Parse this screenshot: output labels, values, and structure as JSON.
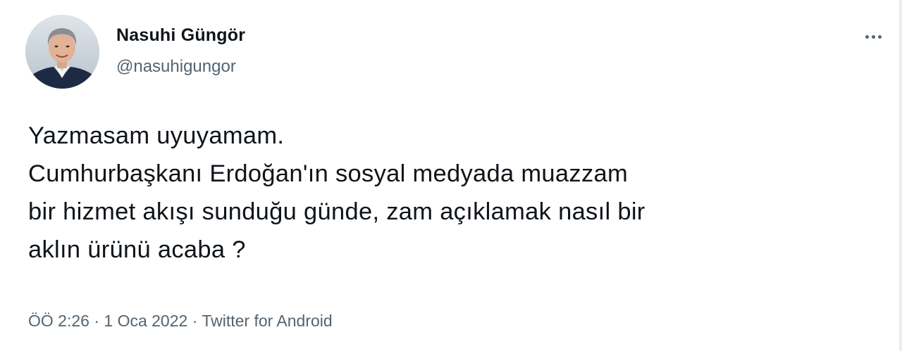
{
  "author": {
    "display_name": "Nasuhi Güngör",
    "handle": "@nasuhigungor",
    "avatar_icon": "profile-photo"
  },
  "more_icon": "ellipsis-icon",
  "tweet": {
    "text": "Yazmasam uyuyamam.\nCumhurbaşkanı Erdoğan'ın sosyal medyada muazzam\nbir hizmet akışı sunduğu günde, zam açıklamak nasıl bir\naklın ürünü acaba ?"
  },
  "meta": {
    "time": "ÖÖ 2:26",
    "separator": " · ",
    "date": "1 Oca 2022",
    "source": "Twitter for Android"
  },
  "colors": {
    "text_primary": "#0f1419",
    "text_secondary": "#536471",
    "background": "#ffffff"
  }
}
